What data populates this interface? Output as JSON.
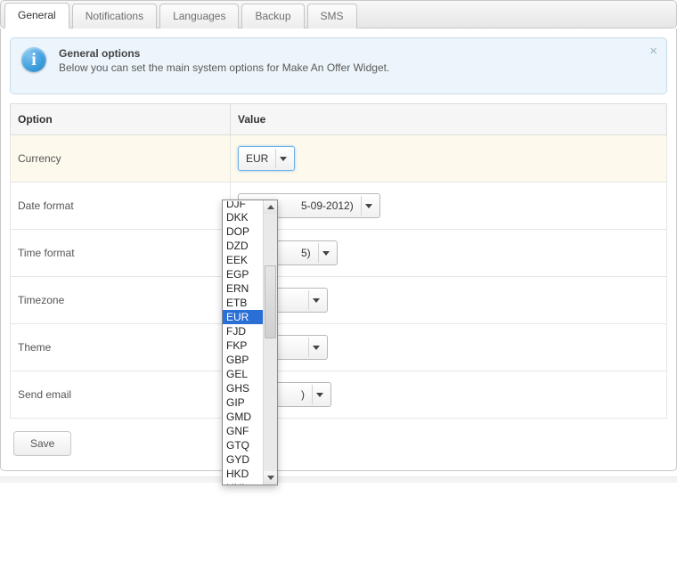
{
  "tabs": [
    "General",
    "Notifications",
    "Languages",
    "Backup",
    "SMS"
  ],
  "active_tab": 0,
  "notice": {
    "title": "General options",
    "desc": "Below you can set the main system options for Make An Offer Widget."
  },
  "table": {
    "header_option": "Option",
    "header_value": "Value",
    "rows": {
      "currency": {
        "label": "Currency",
        "value": "EUR"
      },
      "date_format": {
        "label": "Date format",
        "value_visible": "5-09-2012)"
      },
      "time_format": {
        "label": "Time format",
        "value_visible": "5)"
      },
      "timezone": {
        "label": "Timezone",
        "value_visible": ""
      },
      "theme": {
        "label": "Theme",
        "value_visible": ""
      },
      "send_email": {
        "label": "Send email",
        "value_visible": ")"
      }
    }
  },
  "save_label": "Save",
  "currency_list": {
    "top_clipped": "DJF",
    "items": [
      "DKK",
      "DOP",
      "DZD",
      "EEK",
      "EGP",
      "ERN",
      "ETB",
      "EUR",
      "FJD",
      "FKP",
      "GBP",
      "GEL",
      "GHS",
      "GIP",
      "GMD",
      "GNF",
      "GTQ",
      "GYD",
      "HKD"
    ],
    "bottom_clipped": "HNL",
    "selected": "EUR"
  }
}
